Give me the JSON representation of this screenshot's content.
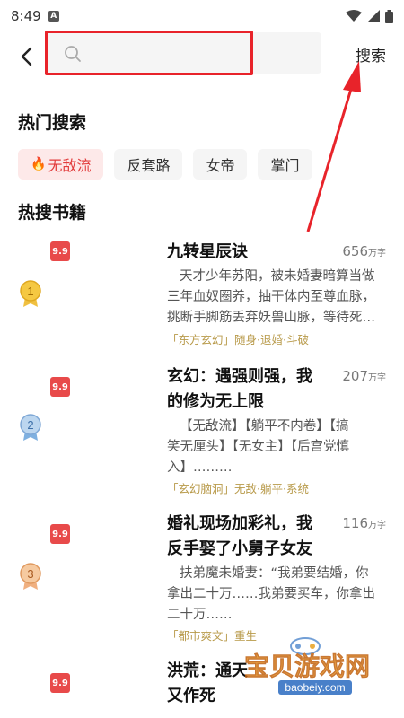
{
  "status_bar": {
    "time": "8:49",
    "app_icon": "A"
  },
  "header": {
    "search_placeholder": "",
    "search_button": "搜索"
  },
  "hot_search": {
    "title": "热门搜索",
    "tags": [
      "无敌流",
      "反套路",
      "女帝",
      "掌门"
    ]
  },
  "hot_books": {
    "title": "热搜书籍",
    "items": [
      {
        "badge": "9.9",
        "rank": "1",
        "title_line1": "九转星辰诀",
        "title_line2": "",
        "wordcount_num": "656",
        "wordcount_unit": "万字",
        "desc1": "天才少年苏阳，被未婚妻暗算当做",
        "desc2": "三年血奴圈养，抽干体内至尊血脉，",
        "desc3": "挑断手脚筋丢弃妖兽山脉，等待死…",
        "tags": "「东方玄幻」随身·退婚·斗破"
      },
      {
        "badge": "9.9",
        "rank": "2",
        "title_line1": "玄幻：遇强则强，我",
        "title_line2": "的修为无上限",
        "wordcount_num": "207",
        "wordcount_unit": "万字",
        "desc1": "【无敌流】【躺平不内卷】【搞",
        "desc2": "笑无厘头】【无女主】【后宫党慎",
        "desc3": "入】………",
        "tags": "「玄幻脑洞」无敌·躺平·系统"
      },
      {
        "badge": "9.9",
        "rank": "3",
        "title_line1": "婚礼现场加彩礼，我",
        "title_line2": "反手娶了小舅子女友",
        "wordcount_num": "116",
        "wordcount_unit": "万字",
        "desc1": "扶弟魔未婚妻：“我弟要结婚，你",
        "desc2": "拿出二十万……我弟要买车，你拿出",
        "desc3": "二十万……",
        "tags": "「都市爽文」重生"
      },
      {
        "badge": "9.9",
        "rank": "",
        "title_line1": "洪荒：通天",
        "title_line2": "又作死",
        "wordcount_num": "",
        "wordcount_unit": "",
        "desc1": "",
        "desc2": "",
        "desc3": "",
        "tags": ""
      }
    ]
  },
  "watermark": {
    "text": "宝贝游戏网",
    "url": "baobeiy.com"
  },
  "colors": {
    "accent_red": "#e8232a",
    "tag_gold": "#b89a4a",
    "hot_tag_bg": "#fde9e9"
  }
}
